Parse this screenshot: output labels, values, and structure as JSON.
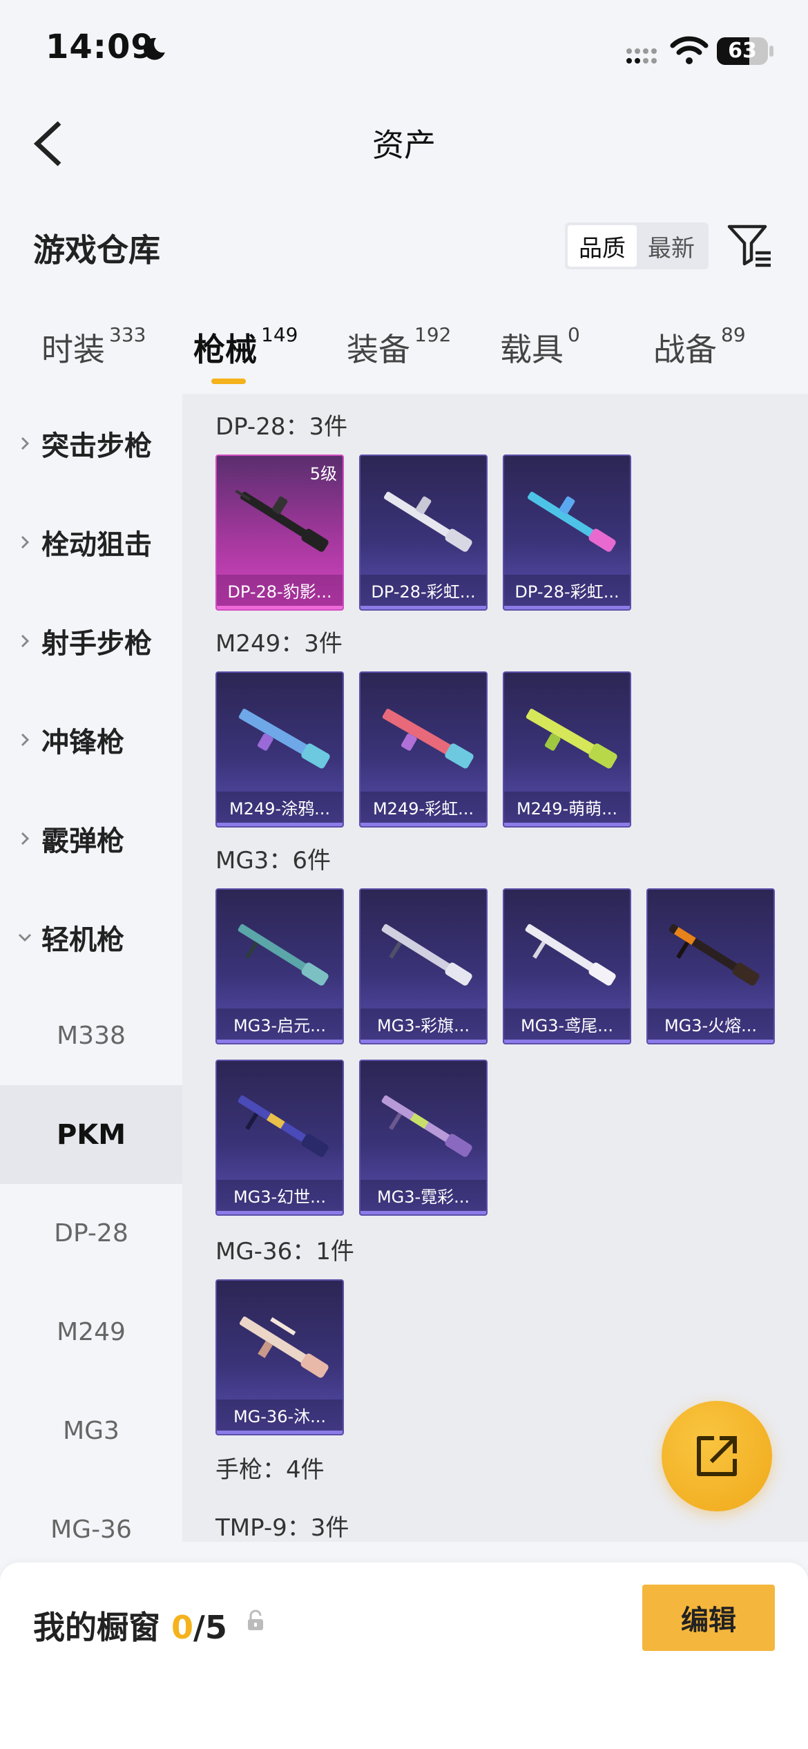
{
  "status_bar": {
    "time": "14:09",
    "battery": "63",
    "battery_level": 0.63
  },
  "header": {
    "title": "资产"
  },
  "warehouse": {
    "title": "游戏仓库",
    "sort_options": [
      "品质",
      "最新"
    ],
    "active_sort": "品质"
  },
  "tabs": [
    {
      "label": "时装",
      "count": "333"
    },
    {
      "label": "枪械",
      "count": "149"
    },
    {
      "label": "装备",
      "count": "192"
    },
    {
      "label": "载具",
      "count": "0"
    },
    {
      "label": "战备",
      "count": "89"
    }
  ],
  "active_tab": "枪械",
  "sidebar": {
    "categories": [
      "突击步枪",
      "栓动狙击",
      "射手步枪",
      "冲锋枪",
      "霰弹枪",
      "轻机枪"
    ],
    "expanded": "轻机枪",
    "sub_items": [
      "M338",
      "PKM",
      "DP-28",
      "M249",
      "MG3",
      "MG-36"
    ],
    "active_sub": "PKM"
  },
  "groups": [
    {
      "title": "DP-28：3件",
      "items": [
        {
          "name": "DP-28-豹影...",
          "tier": "5级",
          "rarity": "pink"
        },
        {
          "name": "DP-28-彩虹...",
          "rarity": "purple"
        },
        {
          "name": "DP-28-彩虹...",
          "rarity": "purple"
        }
      ]
    },
    {
      "title": "M249：3件",
      "items": [
        {
          "name": "M249-涂鸦...",
          "rarity": "purple"
        },
        {
          "name": "M249-彩虹...",
          "rarity": "purple"
        },
        {
          "name": "M249-萌萌...",
          "rarity": "purple"
        }
      ]
    },
    {
      "title": "MG3：6件",
      "items": [
        {
          "name": "MG3-启元...",
          "rarity": "purple"
        },
        {
          "name": "MG3-彩旗...",
          "rarity": "purple"
        },
        {
          "name": "MG3-鸢尾...",
          "rarity": "purple"
        },
        {
          "name": "MG3-火熔...",
          "rarity": "purple"
        },
        {
          "name": "MG3-幻世...",
          "rarity": "purple"
        },
        {
          "name": "MG3-霓彩...",
          "rarity": "purple"
        }
      ]
    },
    {
      "title": "MG-36：1件",
      "items": [
        {
          "name": "MG-36-沐...",
          "rarity": "purple"
        }
      ]
    },
    {
      "title": "手枪：4件",
      "items": []
    },
    {
      "title": "TMP-9：3件",
      "items": []
    }
  ],
  "bottom_bar": {
    "showcase_label": "我的橱窗",
    "showcase_current": "0",
    "showcase_total": "/5",
    "edit_button": "编辑"
  },
  "colors": {
    "accent": "#f4b21c",
    "card_purple": "#3a3378",
    "card_pink": "#d545c2"
  },
  "icons": [
    "moon-icon",
    "signal-icon",
    "wifi-icon",
    "battery-icon",
    "back-chevron-icon",
    "filter-icon",
    "chevron-right-icon",
    "chevron-down-icon",
    "share-icon",
    "lock-icon"
  ]
}
